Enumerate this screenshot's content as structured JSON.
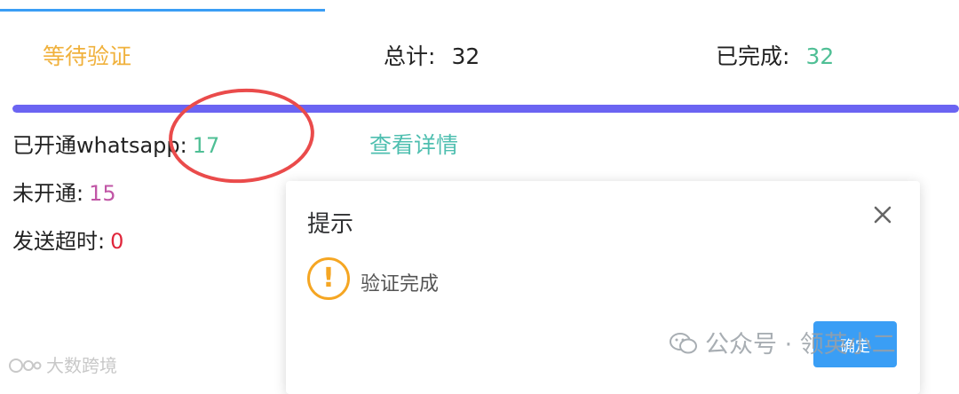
{
  "summary": {
    "status": "等待验证",
    "total_label": "总计:",
    "total_value": "32",
    "completed_label": "已完成:",
    "completed_value": "32"
  },
  "progress": {
    "fraction": 1.0,
    "color": "#6b64f2"
  },
  "stats": {
    "opened_label": "已开通whatsapp:",
    "opened_value": "17",
    "not_opened_label": "未开通:",
    "not_opened_value": "15",
    "timeout_label": "发送超时:",
    "timeout_value": "0"
  },
  "detail_link": "查看详情",
  "dialog": {
    "title": "提示",
    "icon": "warning-icon",
    "message": "验证完成",
    "confirm_label": "确定"
  },
  "watermarks": {
    "wechat": "公众号 · 领英小二",
    "source": "大数跨境"
  },
  "colors": {
    "accent_blue": "#3a9ef5",
    "status_orange": "#f0b13c",
    "value_green": "#4fbf95",
    "value_purple": "#c156a6",
    "value_red": "#e0263b",
    "highlight_circle": "#ea4b4b"
  }
}
